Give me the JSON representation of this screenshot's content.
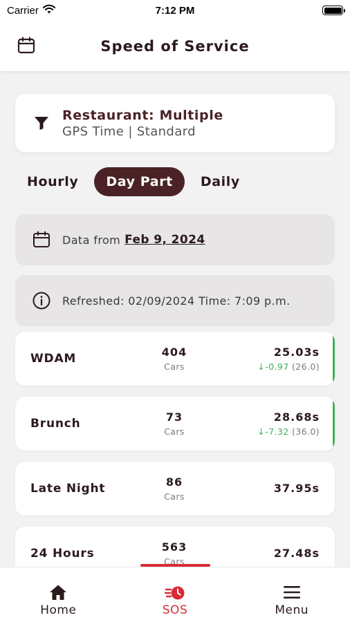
{
  "status_bar": {
    "carrier": "Carrier",
    "time": "7:12 PM"
  },
  "header": {
    "title": "Speed of Service"
  },
  "filter": {
    "title": "Restaurant: Multiple",
    "subtitle": "GPS Time | Standard"
  },
  "tabs": [
    {
      "label": "Hourly",
      "active": false
    },
    {
      "label": "Day Part",
      "active": true
    },
    {
      "label": "Daily",
      "active": false
    }
  ],
  "data_from": {
    "prefix": "Data from",
    "date": "Feb 9, 2024"
  },
  "refreshed": {
    "text": "Refreshed: 02/09/2024 Time: 7:09 p.m."
  },
  "rows": [
    {
      "name": "WDAM",
      "cars": "404",
      "cars_label": "Cars",
      "time": "25.03s",
      "delta_arrow": "↓",
      "delta": "-0.97",
      "prev": "(26.0)"
    },
    {
      "name": "Brunch",
      "cars": "73",
      "cars_label": "Cars",
      "time": "28.68s",
      "delta_arrow": "↓",
      "delta": "-7.32",
      "prev": "(36.0)"
    },
    {
      "name": "Late Night",
      "cars": "86",
      "cars_label": "Cars",
      "time": "37.95s"
    },
    {
      "name": "24 Hours",
      "cars": "563",
      "cars_label": "Cars",
      "time": "27.48s"
    }
  ],
  "nav": [
    {
      "label": "Home",
      "icon": "home-icon",
      "active": false
    },
    {
      "label": "SOS",
      "icon": "sos-timer-icon",
      "active": true
    },
    {
      "label": "Menu",
      "icon": "hamburger-menu-icon",
      "active": false
    }
  ],
  "colors": {
    "brand": "#4a2226",
    "accent_red": "#d62c35",
    "positive_green": "#3fae5a",
    "background": "#f2f2f2"
  }
}
